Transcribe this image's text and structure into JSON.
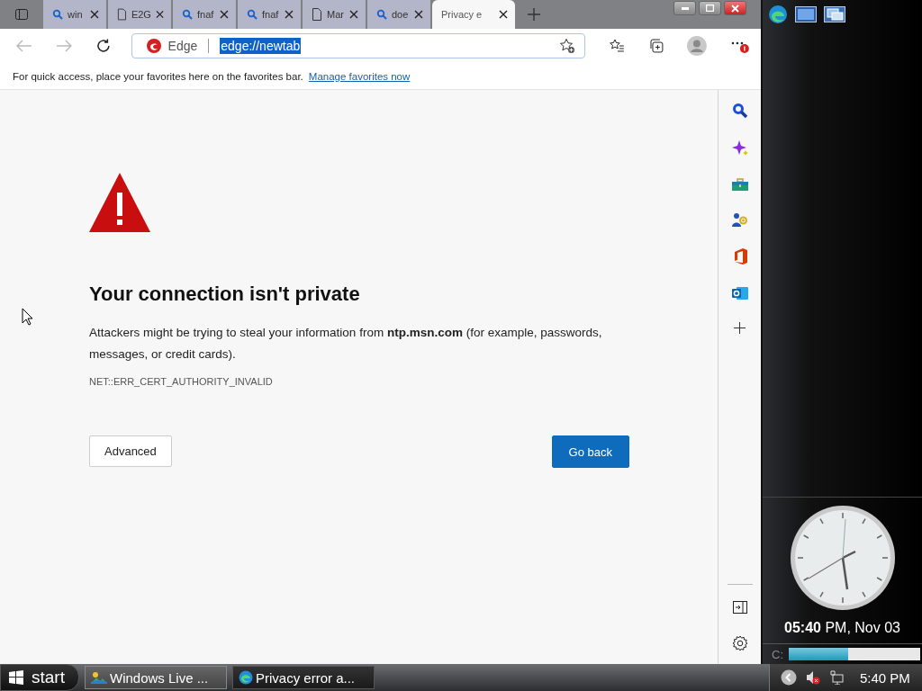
{
  "tabs": [
    {
      "kind": "search",
      "title": "win",
      "selected": false
    },
    {
      "kind": "page",
      "title": "E2G",
      "selected": false
    },
    {
      "kind": "search",
      "title": "fnaf",
      "selected": false
    },
    {
      "kind": "search",
      "title": "fnaf",
      "selected": false
    },
    {
      "kind": "page",
      "title": "Mar",
      "selected": false
    },
    {
      "kind": "search",
      "title": "doe",
      "selected": false
    },
    {
      "kind": "page",
      "title": "Privacy e",
      "selected": true
    }
  ],
  "address": {
    "site_label": "Edge",
    "value": "edge://newtab"
  },
  "favorites_bar": {
    "message": "For quick access, place your favorites here on the favorites bar.",
    "link": "Manage favorites now"
  },
  "error": {
    "title": "Your connection isn't private",
    "message": "Attackers might be trying to steal your information from **ntp.msn.com** (for example, passwords, messages, or credit cards).",
    "code": "NET::ERR_CERT_AUTHORITY_INVALID",
    "buttons": [
      {
        "kind": "secondary",
        "label": "Advanced"
      },
      {
        "kind": "primary",
        "label": "Go back"
      }
    ]
  },
  "clock_gadget": {
    "time": "**05:40** PM, Nov 03"
  },
  "disk_gadget": {
    "drive": "C:",
    "level": 0.45
  },
  "taskbar": {
    "start": "start",
    "items": [
      {
        "kind": "live",
        "label": "Windows Live ...",
        "selected": false
      },
      {
        "kind": "edge",
        "label": "Privacy error a...",
        "selected": true
      }
    ],
    "time": "5:40 PM"
  }
}
